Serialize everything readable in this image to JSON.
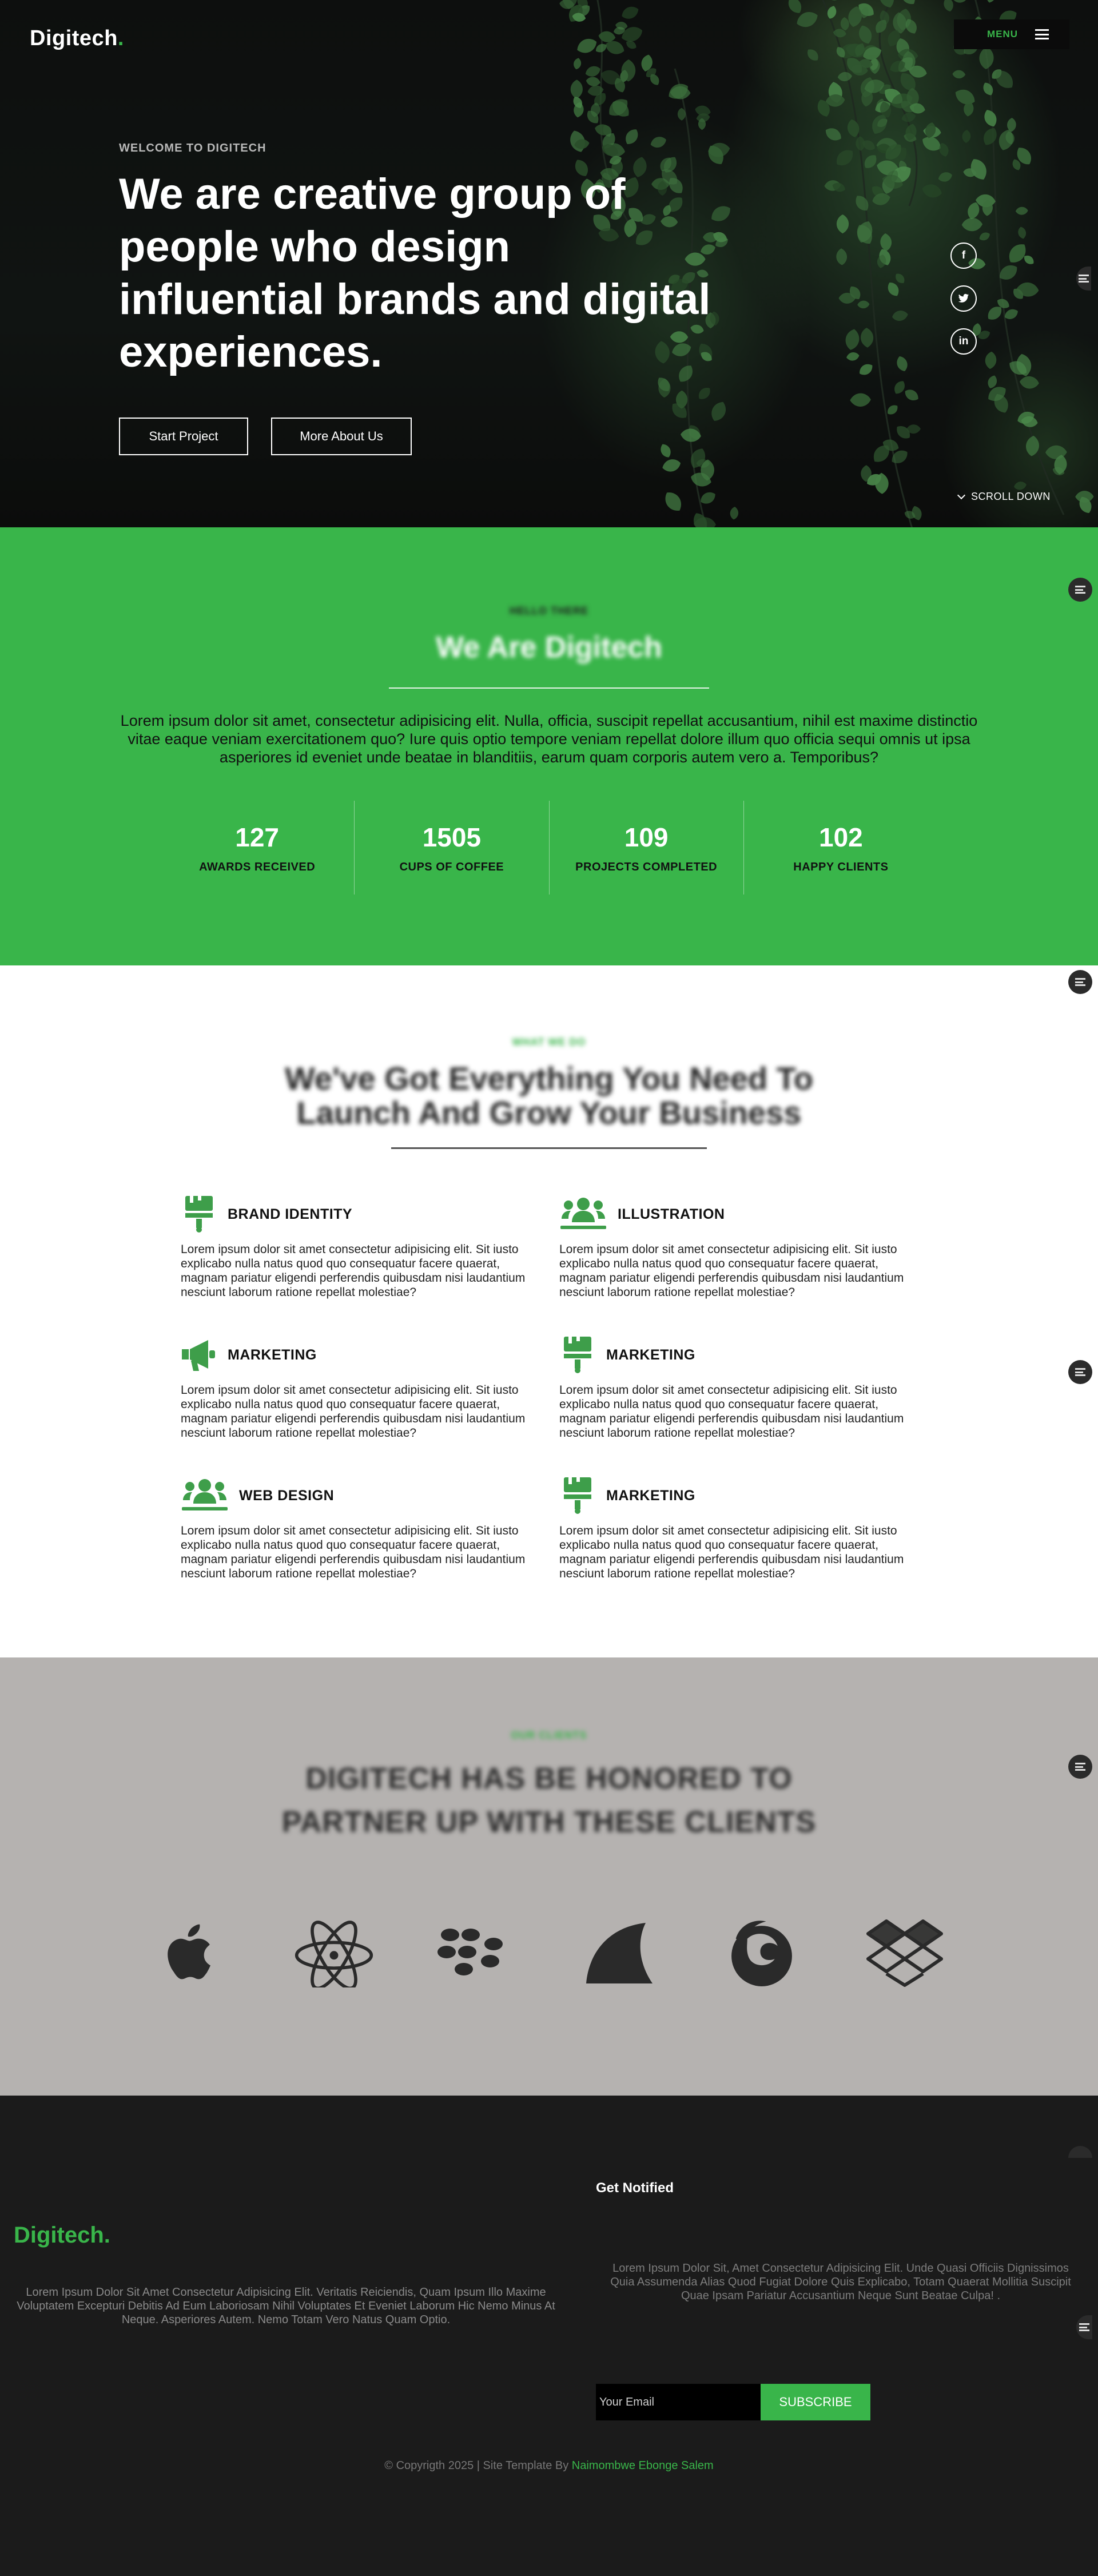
{
  "header": {
    "logo_text": "Digitech",
    "logo_dot": ".",
    "menu_label": "MENU"
  },
  "hero": {
    "eyebrow": "WELCOME TO DIGITECH",
    "title": "We are creative group of people who design influential brands and digital experiences.",
    "primary_button": "Start Project",
    "secondary_button": "More About Us",
    "social": [
      {
        "icon": "facebook-icon",
        "glyph": "f"
      },
      {
        "icon": "twitter-icon",
        "glyph": "t"
      },
      {
        "icon": "linkedin-icon",
        "glyph": "in"
      }
    ],
    "scroll_label": "SCROLL DOWN"
  },
  "about": {
    "eyebrow": "HELLO THERE",
    "heading": "We Are Digitech",
    "paragraph": "Lorem ipsum dolor sit amet, consectetur adipisicing elit. Nulla, officia, suscipit repellat accusantium, nihil est maxime distinctio vitae eaque veniam exercitationem quo? Iure quis optio tempore veniam repellat dolore illum quo officia sequi omnis ut ipsa asperiores id eveniet unde beatae in blanditiis, earum quam corporis autem vero a. Temporibus?",
    "stats": [
      {
        "number": "127",
        "label": "AWARDS RECEIVED"
      },
      {
        "number": "1505",
        "label": "CUPS OF COFFEE"
      },
      {
        "number": "109",
        "label": "PROJECTS COMPLETED"
      },
      {
        "number": "102",
        "label": "HAPPY CLIENTS"
      }
    ]
  },
  "services": {
    "eyebrow": "WHAT WE DO",
    "heading": "We've Got Everything You Need To Launch And Grow Your Business",
    "items": [
      {
        "title": "BRAND IDENTITY",
        "icon": "paint-brush-icon",
        "body": "Lorem ipsum dolor sit amet consectetur adipisicing elit. Sit iusto explicabo nulla natus quod quo consequatur facere quaerat, magnam pariatur eligendi perferendis quibusdam nisi laudantium nesciunt laborum ratione repellat molestiae?"
      },
      {
        "title": "ILLUSTRATION",
        "icon": "users-icon",
        "body": "Lorem ipsum dolor sit amet consectetur adipisicing elit. Sit iusto explicabo nulla natus quod quo consequatur facere quaerat, magnam pariatur eligendi perferendis quibusdam nisi laudantium nesciunt laborum ratione repellat molestiae?"
      },
      {
        "title": "MARKETING",
        "icon": "megaphone-icon",
        "body": "Lorem ipsum dolor sit amet consectetur adipisicing elit. Sit iusto explicabo nulla natus quod quo consequatur facere quaerat, magnam pariatur eligendi perferendis quibusdam nisi laudantium nesciunt laborum ratione repellat molestiae?"
      },
      {
        "title": "MARKETING",
        "icon": "paint-brush-icon",
        "body": "Lorem ipsum dolor sit amet consectetur adipisicing elit. Sit iusto explicabo nulla natus quod quo consequatur facere quaerat, magnam pariatur eligendi perferendis quibusdam nisi laudantium nesciunt laborum ratione repellat molestiae?"
      },
      {
        "title": "WEB DESIGN",
        "icon": "users-icon",
        "body": "Lorem ipsum dolor sit amet consectetur adipisicing elit. Sit iusto explicabo nulla natus quod quo consequatur facere quaerat, magnam pariatur eligendi perferendis quibusdam nisi laudantium nesciunt laborum ratione repellat molestiae?"
      },
      {
        "title": "MARKETING",
        "icon": "paint-brush-icon",
        "body": "Lorem ipsum dolor sit amet consectetur adipisicing elit. Sit iusto explicabo nulla natus quod quo consequatur facere quaerat, magnam pariatur eligendi perferendis quibusdam nisi laudantium nesciunt laborum ratione repellat molestiae?"
      }
    ]
  },
  "clients": {
    "eyebrow": "OUR CLIENTS",
    "heading": "DIGITECH HAS BE HONORED TO PARTNER UP WITH THESE CLIENTS",
    "logos": [
      "apple-logo-icon",
      "atom-logo-icon",
      "blackberry-logo-icon",
      "shark-fin-logo-icon",
      "firefox-logo-icon",
      "dropbox-logo-icon"
    ]
  },
  "footer": {
    "logo_text": "Digitech.",
    "about_text": "Lorem Ipsum Dolor Sit Amet Consectetur Adipisicing Elit. Veritatis Reiciendis, Quam Ipsum Illo Maxime Voluptatem Excepturi Debitis Ad Eum Laboriosam Nihil Voluptates Et Eveniet Laborum Hic Nemo Minus At Neque. Asperiores Autem. Nemo Totam Vero Natus Quam Optio.",
    "newsletter_title": "Get Notified",
    "newsletter_text": "Lorem Ipsum Dolor Sit, Amet Consectetur Adipisicing Elit. Unde Quasi Officiis Dignissimos Quia Assumenda Alias Quod Fugiat Dolore Quis Explicabo, Totam Quaerat Mollitia Suscipit Quae Ipsam Pariatur Accusantium Neque Sunt Beatae Culpa! .",
    "email_placeholder": "Your Email",
    "subscribe_label": "SUBSCRIBE",
    "copyright": "© Copyrigth 2025 | Site Template By",
    "author": "Naimombwe Ebonge Salem"
  },
  "colors": {
    "accent_green": "#39b54a",
    "dark": "#1b1b1b",
    "clients_bg": "#b5b2b0"
  }
}
